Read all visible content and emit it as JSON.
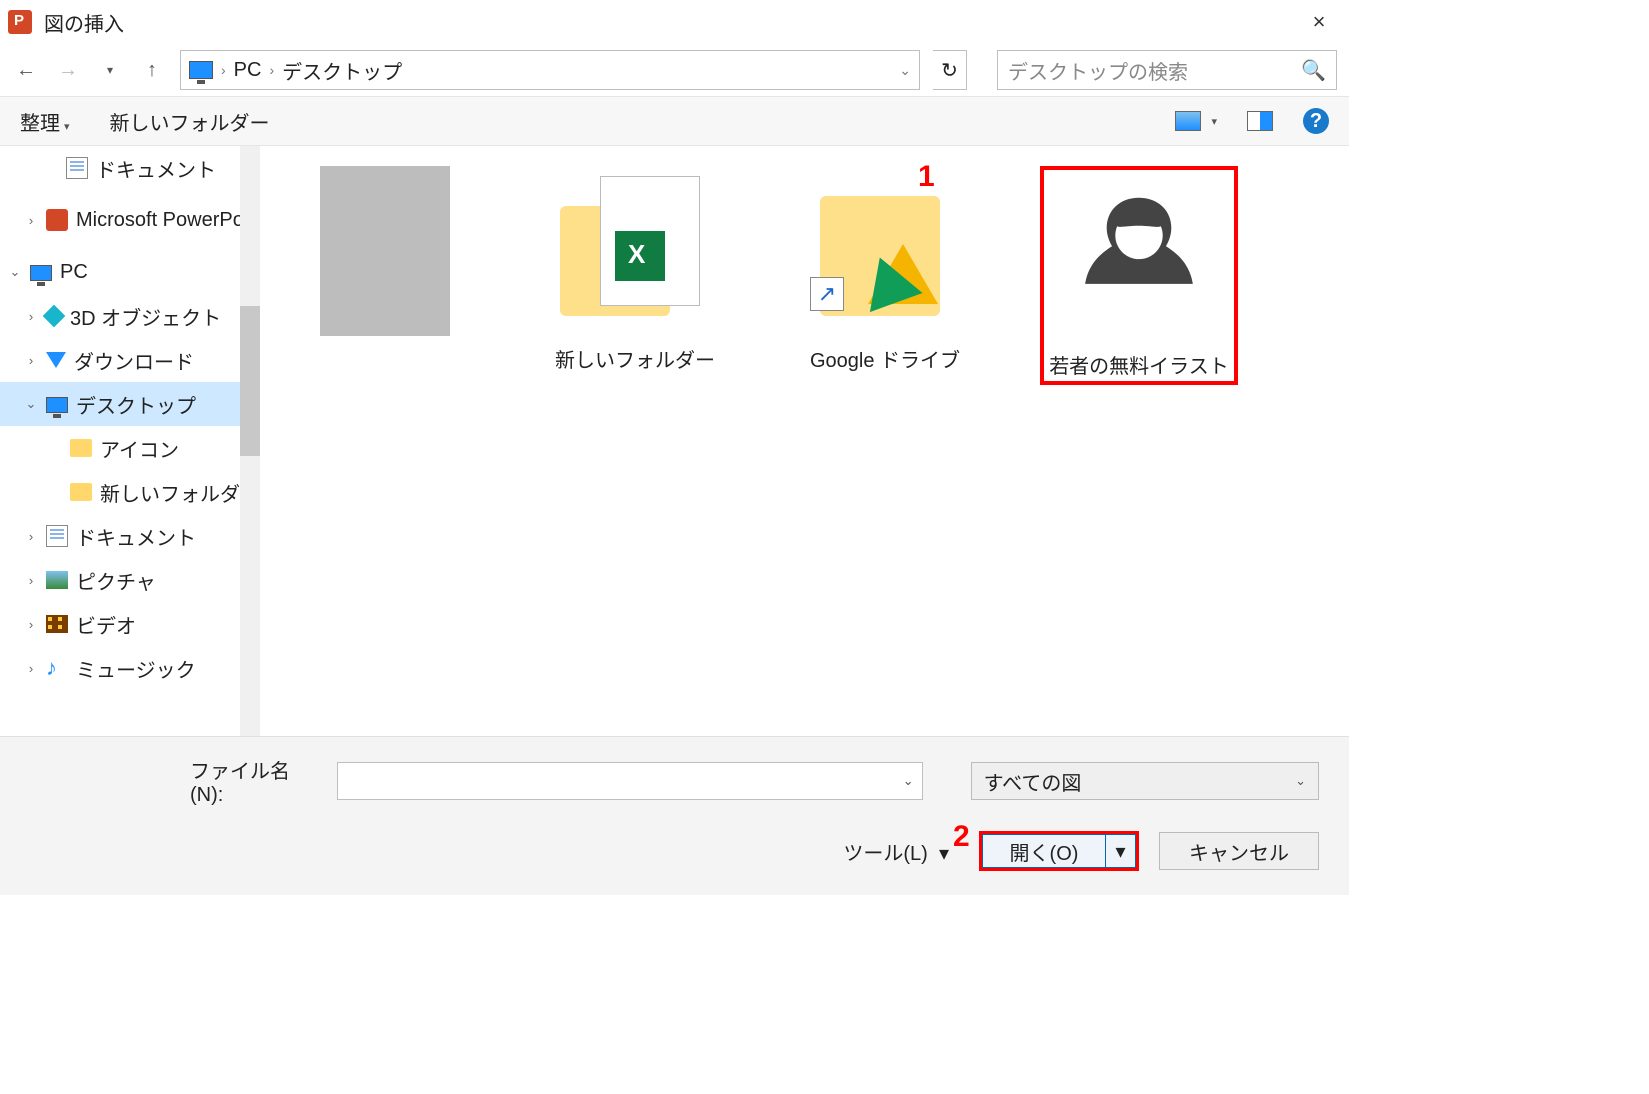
{
  "title": "図の挿入",
  "path": {
    "seg1": "PC",
    "seg2": "デスクトップ"
  },
  "search_placeholder": "デスクトップの検索",
  "toolbar": {
    "organize": "整理",
    "newfolder": "新しいフォルダー"
  },
  "tree": {
    "documents_top": "ドキュメント",
    "powerpoint": "Microsoft PowerPo",
    "pc": "PC",
    "obj3d": "3D オブジェクト",
    "downloads": "ダウンロード",
    "desktop": "デスクトップ",
    "icons": "アイコン",
    "newfolder": "新しいフォルダー",
    "documents": "ドキュメント",
    "pictures": "ピクチャ",
    "videos": "ビデオ",
    "music": "ミュージック"
  },
  "items": {
    "newfolder": "新しいフォルダー",
    "gdrive": "Google ドライブ",
    "avatar": "若者の無料イラスト"
  },
  "bottom": {
    "filename_label": "ファイル名(N):",
    "filter": "すべての図",
    "tools": "ツール(L)",
    "open": "開く(O)",
    "cancel": "キャンセル"
  },
  "annot": {
    "one": "1",
    "two": "2"
  }
}
